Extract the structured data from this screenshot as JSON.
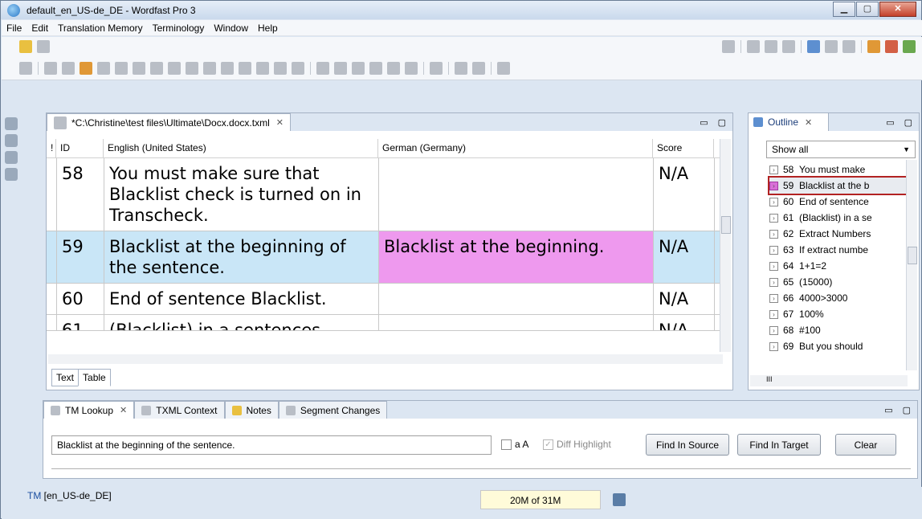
{
  "window": {
    "title": "default_en_US-de_DE - Wordfast Pro 3"
  },
  "menu": [
    "File",
    "Edit",
    "Translation Memory",
    "Terminology",
    "Window",
    "Help"
  ],
  "editor": {
    "tab_label": "*C:\\Christine\\test files\\Ultimate\\Docx.docx.txml",
    "columns": [
      "!",
      "ID",
      "English (United States)",
      "German (Germany)",
      "Score"
    ],
    "rows": [
      {
        "id": "58",
        "source": "You must make sure that Blacklist check is turned on in Transcheck.",
        "target": "",
        "score": "N/A",
        "selected": false
      },
      {
        "id": "59",
        "source": "Blacklist at the beginning of the sentence.",
        "target": "Blacklist at the beginning.",
        "score": "N/A",
        "selected": true
      },
      {
        "id": "60",
        "source": "End of sentence Blacklist.",
        "target": "",
        "score": "N/A",
        "selected": false
      },
      {
        "id": "61",
        "source": "(Blacklist) in a sentences",
        "target": "",
        "score": "N/A",
        "selected": false
      }
    ],
    "bottom_tabs": [
      "Text",
      "Table"
    ]
  },
  "outline": {
    "tab_label": "Outline",
    "filter": "Show all",
    "items": [
      {
        "id": "58",
        "text": "You must make"
      },
      {
        "id": "59",
        "text": "Blacklist at the b"
      },
      {
        "id": "60",
        "text": "End of sentence"
      },
      {
        "id": "61",
        "text": "(Blacklist) in a se"
      },
      {
        "id": "62",
        "text": "Extract Numbers"
      },
      {
        "id": "63",
        "text": "If extract numbe"
      },
      {
        "id": "64",
        "text": "1+1=2"
      },
      {
        "id": "65",
        "text": "(15000)"
      },
      {
        "id": "66",
        "text": "4000>3000"
      },
      {
        "id": "67",
        "text": "100%"
      },
      {
        "id": "68",
        "text": "#100"
      },
      {
        "id": "69",
        "text": "But you should"
      }
    ],
    "scroll_label": "III"
  },
  "tm_panel": {
    "tabs": [
      "TM Lookup",
      "TXML Context",
      "Notes",
      "Segment Changes"
    ],
    "lookup_value": "Blacklist at the beginning of the sentence.",
    "checkbox_aa": "a A",
    "checkbox_diff": "Diff Highlight",
    "find_source": "Find In Source",
    "find_target": "Find In Target",
    "clear": "Clear"
  },
  "status": {
    "tm": "TM",
    "tm_pair": "[en_US-de_DE]",
    "memory": "20M of 31M"
  },
  "colors": {
    "row_selected": "#c9e6f7",
    "target_selected": "#ee99ee",
    "highlight_border": "#b22222"
  }
}
